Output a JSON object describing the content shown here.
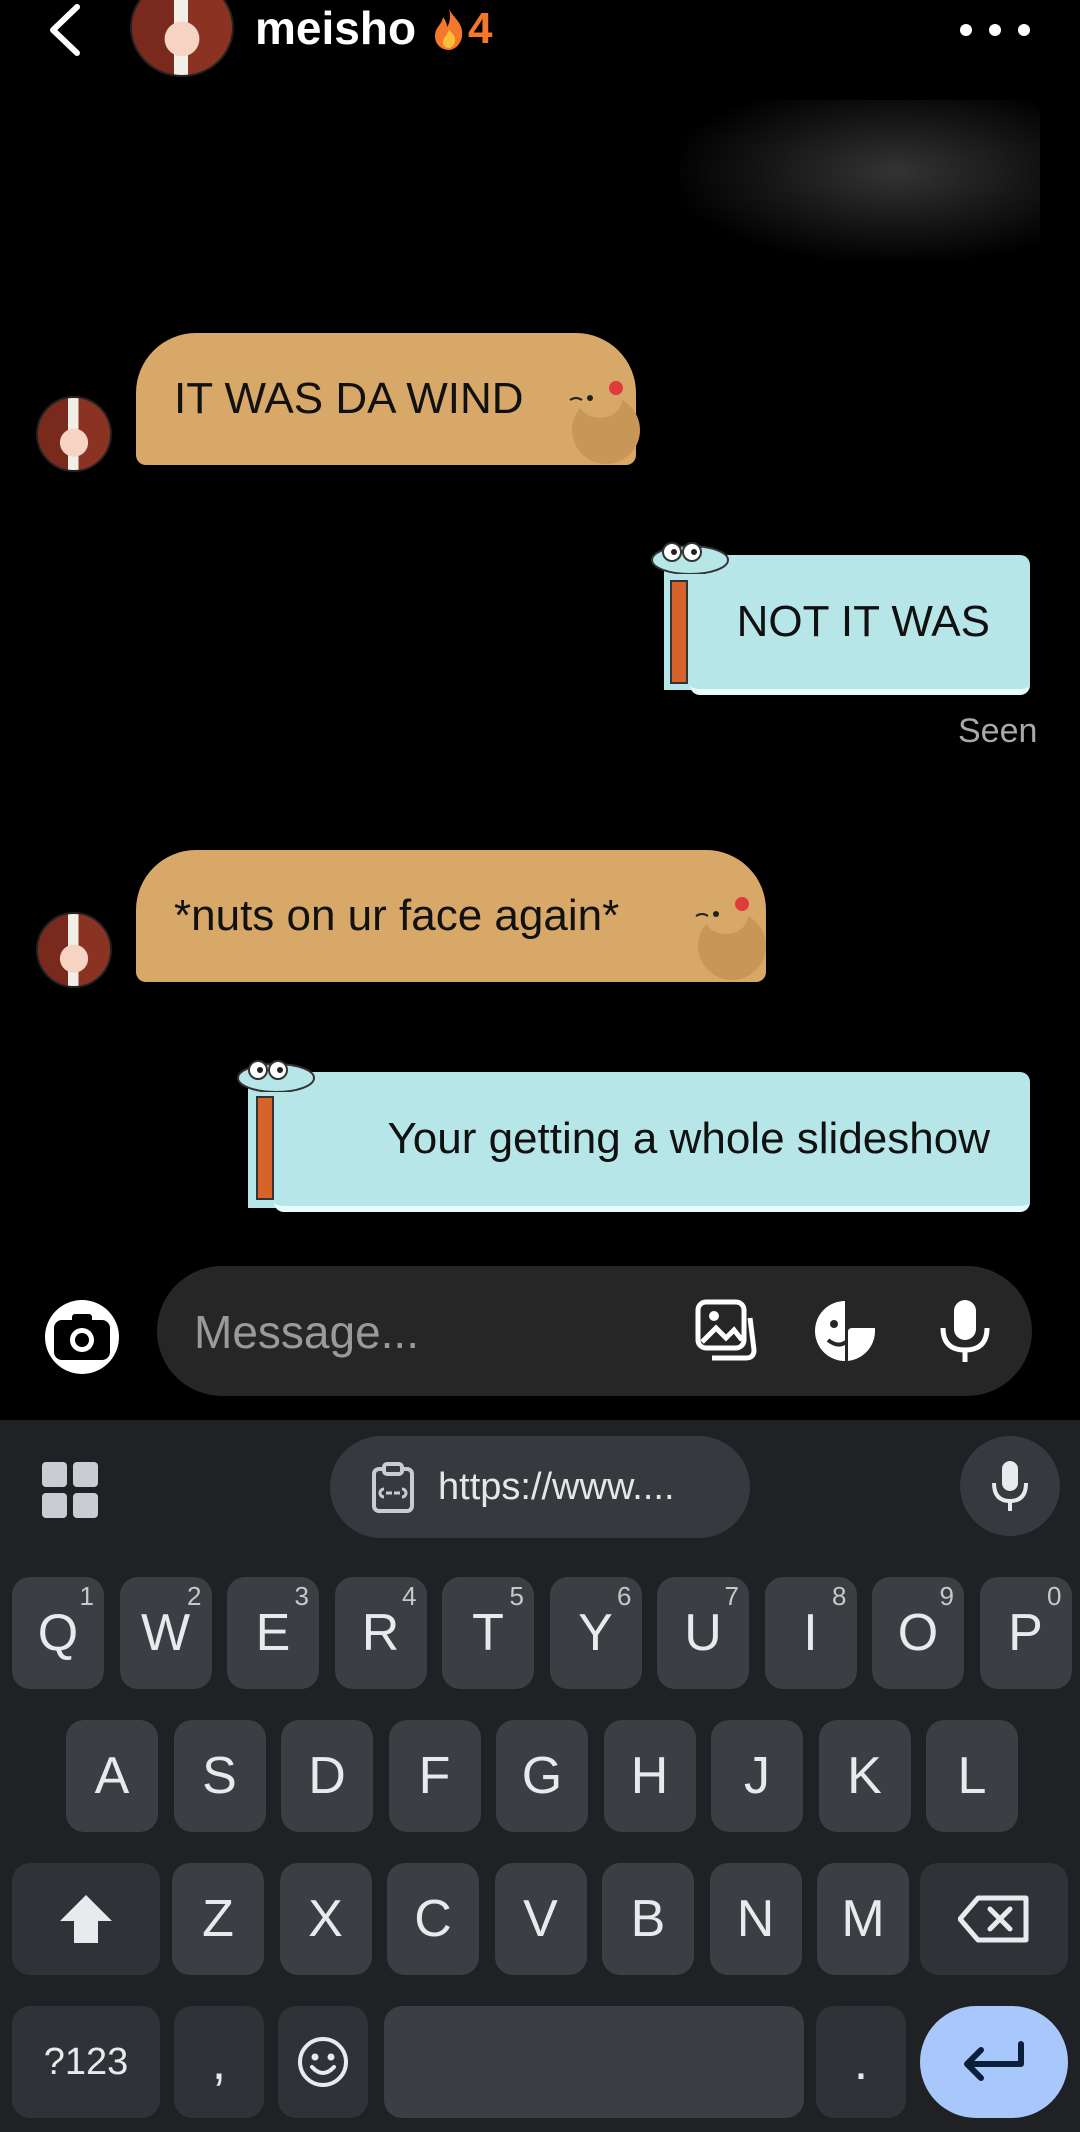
{
  "header": {
    "contact_name": "meisho",
    "streak_count": "4",
    "streak_icon": "fire-icon",
    "more_icon": "more-horizontal-icon",
    "back_icon": "chevron-left-icon"
  },
  "messages": [
    {
      "from": "them",
      "text": "IT WAS DA WIND",
      "style": "capybara"
    },
    {
      "from": "me",
      "text": "NOT IT WAS",
      "style": "crocodile",
      "status": "Seen"
    },
    {
      "from": "them",
      "text": "*nuts on ur face again*",
      "style": "capybara"
    },
    {
      "from": "me",
      "text": "Your getting a whole slideshow",
      "style": "crocodile"
    }
  ],
  "composer": {
    "placeholder": "Message...",
    "icons": [
      "camera-icon",
      "gallery-icon",
      "sticker-icon",
      "microphone-icon"
    ]
  },
  "keyboard": {
    "clipboard_suggestion": "https://www....",
    "row1": [
      {
        "k": "Q",
        "h": "1"
      },
      {
        "k": "W",
        "h": "2"
      },
      {
        "k": "E",
        "h": "3"
      },
      {
        "k": "R",
        "h": "4"
      },
      {
        "k": "T",
        "h": "5"
      },
      {
        "k": "Y",
        "h": "6"
      },
      {
        "k": "U",
        "h": "7"
      },
      {
        "k": "I",
        "h": "8"
      },
      {
        "k": "O",
        "h": "9"
      },
      {
        "k": "P",
        "h": "0"
      }
    ],
    "row2": [
      "A",
      "S",
      "D",
      "F",
      "G",
      "H",
      "J",
      "K",
      "L"
    ],
    "row3": [
      "Z",
      "X",
      "C",
      "V",
      "B",
      "N",
      "M"
    ],
    "symbols_key": "?123",
    "comma_key": ",",
    "period_key": "."
  },
  "colors": {
    "capy_bubble": "#d8a868",
    "croc_bubble": "#b7e6e8",
    "streak": "#f4772a",
    "enter_key": "#a8c7fa"
  }
}
